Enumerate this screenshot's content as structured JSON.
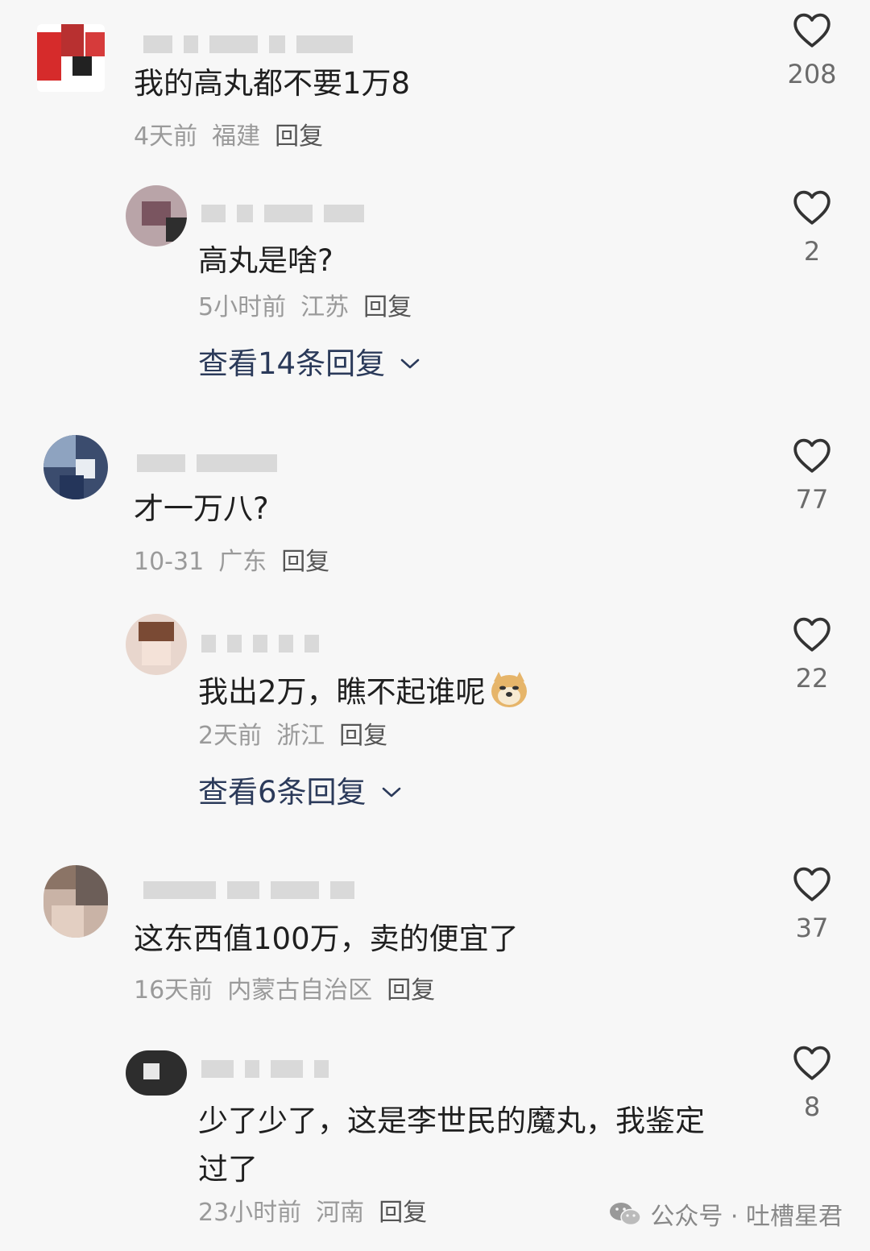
{
  "comments": [
    {
      "text": "我的高丸都不要1万8",
      "time": "4天前",
      "region": "福建",
      "reply": "回复",
      "likes": "208"
    },
    {
      "text": "高丸是啥?",
      "time": "5小时前",
      "region": "江苏",
      "reply": "回复",
      "likes": "2",
      "more": "查看14条回复"
    },
    {
      "text": "才一万八?",
      "time": "10-31",
      "region": "广东",
      "reply": "回复",
      "likes": "77"
    },
    {
      "text": "我出2万，瞧不起谁呢",
      "time": "2天前",
      "region": "浙江",
      "reply": "回复",
      "likes": "22",
      "more": "查看6条回复"
    },
    {
      "text": "这东西值100万，卖的便宜了",
      "time": "16天前",
      "region": "内蒙古自治区",
      "reply": "回复",
      "likes": "37"
    },
    {
      "text_line1": "少了少了，这是李世民的魔丸，我鉴定",
      "text_line2": "过了",
      "time": "23小时前",
      "region": "河南",
      "reply": "回复",
      "likes": "8"
    }
  ],
  "watermark": {
    "text": "公众号 · 吐槽星君"
  },
  "colors": {
    "background": "#f7f7f7",
    "link": "#2b3a5a",
    "meta": "#9a9a9a",
    "heart": "#333333"
  },
  "icons": {
    "like": "heart-outline-icon",
    "expand": "chevron-down-icon",
    "wechat": "wechat-icon",
    "emoji": "doge-emoji-icon"
  }
}
